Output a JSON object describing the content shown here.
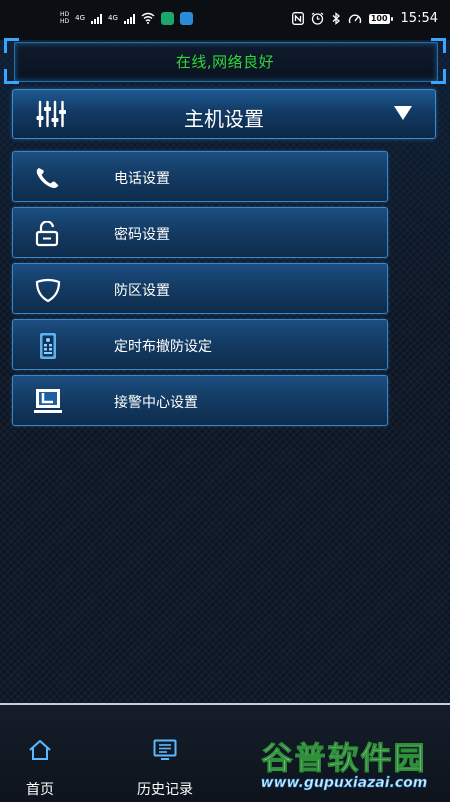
{
  "status_bar": {
    "hd_top": "HD",
    "hd_bottom": "HD",
    "net_1": "4G",
    "net_2": "4G",
    "battery": "100",
    "time": "15:54"
  },
  "banner": {
    "status_text": "在线,网络良好",
    "status_color": "#2fd63c"
  },
  "header": {
    "title": "主机设置",
    "left_icon": "sliders-icon",
    "dropdown_icon": "triangle-down-icon"
  },
  "menu": {
    "items": [
      {
        "label": "电话设置",
        "icon": "phone-icon"
      },
      {
        "label": "密码设置",
        "icon": "unlock-icon"
      },
      {
        "label": "防区设置",
        "icon": "shield-icon"
      },
      {
        "label": "定时布撤防设定",
        "icon": "remote-icon"
      },
      {
        "label": "接警中心设置",
        "icon": "monitor-icon"
      }
    ]
  },
  "bottom_nav": {
    "items": [
      {
        "label": "首页",
        "icon": "home-icon"
      },
      {
        "label": "历史记录",
        "icon": "history-icon"
      }
    ]
  },
  "watermark": {
    "title": "谷普软件园",
    "url": "www.gupuxiazai.com"
  },
  "colors": {
    "accent_blue": "#3a86c8",
    "online_green": "#2fd63c"
  }
}
